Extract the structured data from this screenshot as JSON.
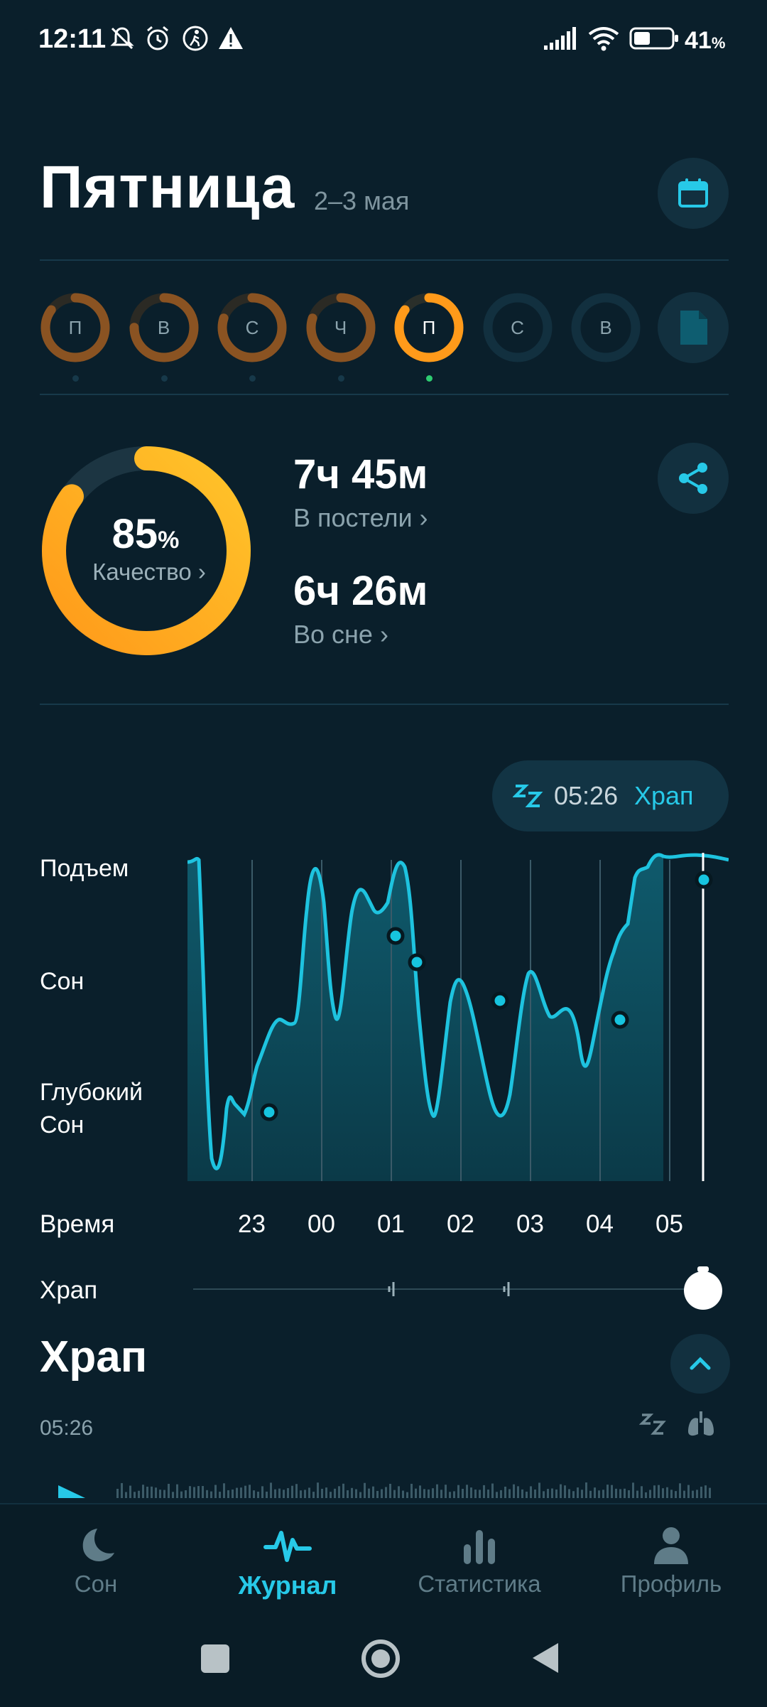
{
  "status_bar": {
    "time": "12:11",
    "battery": "41",
    "battery_unit": "%"
  },
  "header": {
    "day": "Пятница",
    "date_range": "2–3 мая"
  },
  "week": [
    {
      "label": "П",
      "progress": 0.85,
      "color": "#7a4a1e"
    },
    {
      "label": "В",
      "progress": 0.75,
      "color": "#7a4a1e"
    },
    {
      "label": "С",
      "progress": 0.8,
      "color": "#7a4a1e"
    },
    {
      "label": "Ч",
      "progress": 0.8,
      "color": "#7a4a1e"
    },
    {
      "label": "П",
      "progress": 0.85,
      "color": "#ff9a1a",
      "selected": true
    },
    {
      "label": "С",
      "progress": 0,
      "color": "#12303f"
    },
    {
      "label": "В",
      "progress": 0,
      "color": "#12303f"
    }
  ],
  "summary": {
    "quality_value": "85",
    "quality_unit": "%",
    "quality_label": "Качество ›",
    "in_bed_value": "7ч 45м",
    "in_bed_label": "В постели ›",
    "asleep_value": "6ч 26м",
    "asleep_label": "Во сне ›"
  },
  "snore_pill": {
    "time": "05:26",
    "label": "Храп"
  },
  "chart_data": {
    "type": "area",
    "ylabels": [
      "Подъем",
      "Сон",
      "Глубокий Сон"
    ],
    "xlabel": "Время",
    "xticks": [
      "23",
      "00",
      "01",
      "02",
      "03",
      "04",
      "05"
    ]
  },
  "snore_row": {
    "label": "Храп"
  },
  "section": {
    "title": "Храп",
    "time": "05:26"
  },
  "nav": {
    "sleep": "Сон",
    "journal": "Журнал",
    "stats": "Статистика",
    "profile": "Профиль"
  },
  "colors": {
    "accent": "#27c9e8",
    "orange": "#ff9a1a",
    "background": "#0a1f2b"
  }
}
